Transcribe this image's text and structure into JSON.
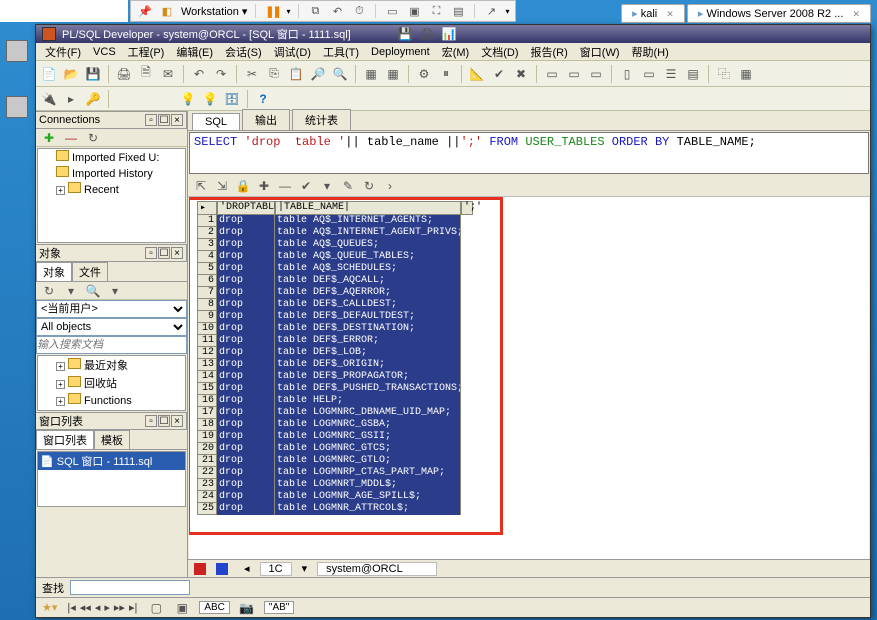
{
  "vm": {
    "workstation": "Workstation",
    "tabs": {
      "kali": "kali",
      "winserver": "Windows Server 2008 R2 ..."
    }
  },
  "app": {
    "title_prefix": "PL/SQL Developer",
    "title_user": "system@ORCL",
    "title_file": "[SQL 窗口 - 1111.sql]"
  },
  "menu": {
    "file": "文件(F)",
    "vcs": "VCS",
    "project": "工程(P)",
    "edit": "编辑(E)",
    "session": "会话(S)",
    "debug": "调试(D)",
    "tools": "工具(T)",
    "deployment": "Deployment",
    "macro": "宏(M)",
    "document": "文档(D)",
    "report": "报告(R)",
    "window": "窗口(W)",
    "help": "帮助(H)"
  },
  "panels": {
    "connections": "Connections",
    "conn_items": {
      "fixed": "Imported Fixed U:",
      "history": "Imported History",
      "recent": "Recent"
    },
    "objects": "对象",
    "obj_tabs": {
      "a": "对象",
      "b": "文件"
    },
    "current_user": "<当前用户>",
    "all_objects": "All objects",
    "search_ph": "输入搜索文档",
    "obj_tree": {
      "recent": "最近对象",
      "recycle": "回收站",
      "functions": "Functions"
    },
    "winlist": "窗口列表",
    "winlist_tabs": {
      "a": "窗口列表",
      "b": "模板"
    },
    "winlist_item": "SQL 窗口 - 1111.sql"
  },
  "sql_tabs": {
    "sql": "SQL",
    "output": "输出",
    "stats": "统计表"
  },
  "sql_text": {
    "p1": "SELECT",
    "p2": "'drop",
    "p3": "table '",
    "p4": "||",
    "p5": "table_name",
    "p6": "||",
    "p7": "';'",
    "p8": "FROM",
    "p9": "USER_TABLES",
    "p10": "ORDER",
    "p11": "BY",
    "p12": "TABLE_NAME;"
  },
  "grid_headers": {
    "h1": "'DROPTABLE'",
    "h2": "|TABLE_NAME|",
    "h3": "';'"
  },
  "grid_rows": [
    {
      "n": 1,
      "a": "drop",
      "b": "table AQ$_INTERNET_AGENTS;"
    },
    {
      "n": 2,
      "a": "drop",
      "b": "table AQ$_INTERNET_AGENT_PRIVS;"
    },
    {
      "n": 3,
      "a": "drop",
      "b": "table AQ$_QUEUES;"
    },
    {
      "n": 4,
      "a": "drop",
      "b": "table AQ$_QUEUE_TABLES;"
    },
    {
      "n": 5,
      "a": "drop",
      "b": "table AQ$_SCHEDULES;"
    },
    {
      "n": 6,
      "a": "drop",
      "b": "table DEF$_AQCALL;"
    },
    {
      "n": 7,
      "a": "drop",
      "b": "table DEF$_AQERROR;"
    },
    {
      "n": 8,
      "a": "drop",
      "b": "table DEF$_CALLDEST;"
    },
    {
      "n": 9,
      "a": "drop",
      "b": "table DEF$_DEFAULTDEST;"
    },
    {
      "n": 10,
      "a": "drop",
      "b": "table DEF$_DESTINATION;"
    },
    {
      "n": 11,
      "a": "drop",
      "b": "table DEF$_ERROR;"
    },
    {
      "n": 12,
      "a": "drop",
      "b": "table DEF$_LOB;"
    },
    {
      "n": 13,
      "a": "drop",
      "b": "table DEF$_ORIGIN;"
    },
    {
      "n": 14,
      "a": "drop",
      "b": "table DEF$_PROPAGATOR;"
    },
    {
      "n": 15,
      "a": "drop",
      "b": "table DEF$_PUSHED_TRANSACTIONS;"
    },
    {
      "n": 16,
      "a": "drop",
      "b": "table HELP;"
    },
    {
      "n": 17,
      "a": "drop",
      "b": "table LOGMNRC_DBNAME_UID_MAP;"
    },
    {
      "n": 18,
      "a": "drop",
      "b": "table LOGMNRC_GSBA;"
    },
    {
      "n": 19,
      "a": "drop",
      "b": "table LOGMNRC_GSII;"
    },
    {
      "n": 20,
      "a": "drop",
      "b": "table LOGMNRC_GTCS;"
    },
    {
      "n": 21,
      "a": "drop",
      "b": "table LOGMNRC_GTLO;"
    },
    {
      "n": 22,
      "a": "drop",
      "b": "table LOGMNRP_CTAS_PART_MAP;"
    },
    {
      "n": 23,
      "a": "drop",
      "b": "table LOGMNRT_MDDL$;"
    },
    {
      "n": 24,
      "a": "drop",
      "b": "table LOGMNR_AGE_SPILL$;"
    },
    {
      "n": 25,
      "a": "drop",
      "b": "table LOGMNR_ATTRCOL$;"
    }
  ],
  "status": {
    "rowcol": "1C",
    "conn": "system@ORCL"
  },
  "find": {
    "label": "查找"
  },
  "bottom": {
    "abc": "ABC",
    "ab": "\"AB\""
  }
}
